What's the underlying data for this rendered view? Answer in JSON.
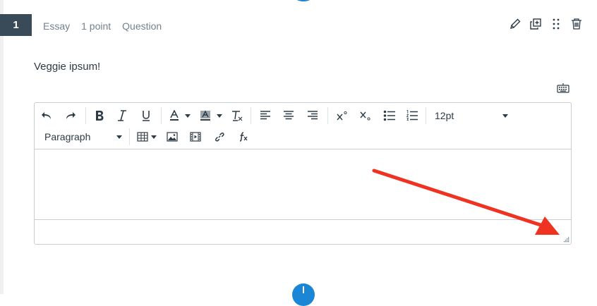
{
  "question": {
    "number": "1",
    "type": "Essay",
    "points": "1 point",
    "label": "Question",
    "prompt": "Veggie ipsum!"
  },
  "toolbar": {
    "font_size": "12pt",
    "block_format": "Paragraph"
  },
  "colors": {
    "number_badge": "#394b58",
    "accent_blue": "#1b85d6",
    "annotation_arrow": "#ee3322"
  },
  "icons": [
    "edit-pencil-icon",
    "duplicate-icon",
    "drag-handle-icon",
    "trash-icon",
    "keyboard-icon",
    "undo-icon",
    "redo-icon",
    "bold-icon",
    "italic-icon",
    "underline-icon",
    "text-color-icon",
    "background-color-icon",
    "clear-formatting-icon",
    "align-left-icon",
    "align-center-icon",
    "align-right-icon",
    "superscript-icon",
    "subscript-icon",
    "bullet-list-icon",
    "numbered-list-icon",
    "table-icon",
    "image-icon",
    "media-icon",
    "link-icon",
    "equation-icon",
    "resize-handle-icon"
  ]
}
